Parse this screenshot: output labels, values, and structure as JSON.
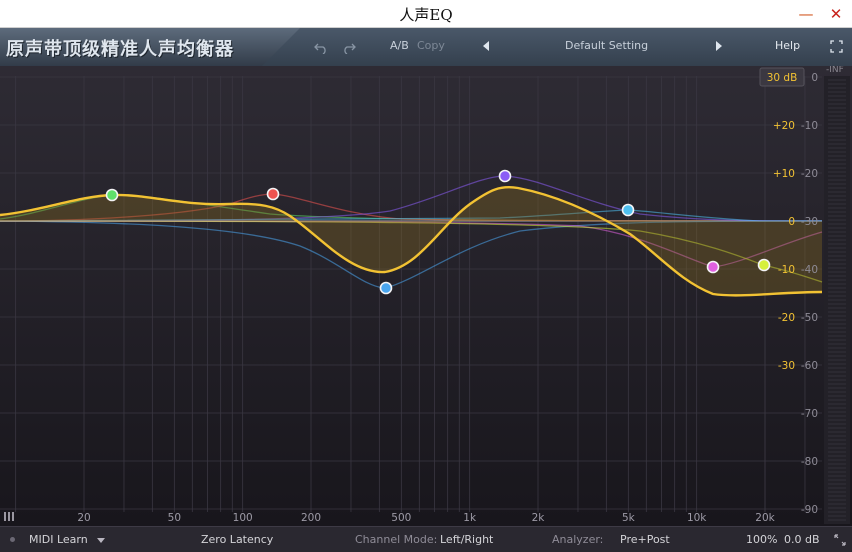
{
  "window": {
    "title": "人声EQ",
    "minimize_glyph": "—",
    "close_glyph": "✕"
  },
  "toolbar": {
    "banner_text": "原声带顶级精准人声均衡器",
    "undo_icon": "undo-icon",
    "redo_icon": "redo-icon",
    "ab_label": "A/B",
    "copy_label": "Copy",
    "preset_name": "Default Setting",
    "help_label": "Help",
    "fullscreen_icon": "fullscreen-icon"
  },
  "plot": {
    "range_badge": "30 dB",
    "meter_top_label": "-INF",
    "eq_gain_labels": [
      "+20",
      "+10",
      "0",
      "-10",
      "-20",
      "-30"
    ],
    "spectrum_labels": [
      "0",
      "-10",
      "-20",
      "-30",
      "-40",
      "-50",
      "-60",
      "-70",
      "-80",
      "-90"
    ],
    "freq_labels": [
      "20",
      "50",
      "100",
      "200",
      "500",
      "1k",
      "2k",
      "5k",
      "10k",
      "20k"
    ],
    "bands": [
      {
        "name": "band-1",
        "color": "#5fe06a"
      },
      {
        "name": "band-2",
        "color": "#ef5350"
      },
      {
        "name": "band-3",
        "color": "#4aa6ef"
      },
      {
        "name": "band-4",
        "color": "#8a5cf5"
      },
      {
        "name": "band-5",
        "color": "#4fc0f0"
      },
      {
        "name": "band-6",
        "color": "#e060e0"
      },
      {
        "name": "band-7",
        "color": "#d6f03a"
      }
    ],
    "curve_color": "#f2c233"
  },
  "bottombar": {
    "midi_learn": "MIDI Learn",
    "latency": "Zero Latency",
    "channel_mode_label": "Channel Mode:",
    "channel_mode_value": "Left/Right",
    "analyzer_label": "Analyzer:",
    "analyzer_value": "Pre+Post",
    "zoom": "100%",
    "output_gain": "0.0 dB"
  }
}
